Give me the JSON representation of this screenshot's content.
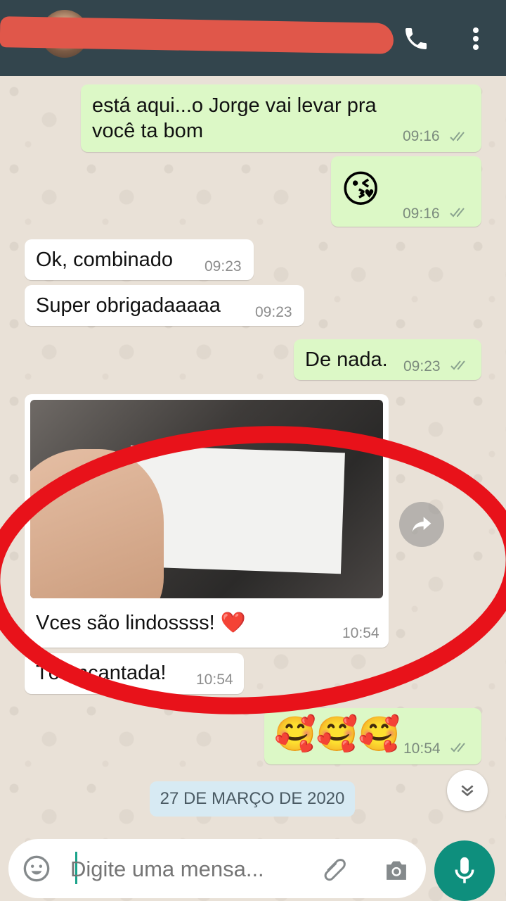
{
  "header": {
    "contact_name": "",
    "call_icon": "phone-icon",
    "menu_icon": "more-vert-icon"
  },
  "messages": [
    {
      "side": "out",
      "text_line1": "está aqui...o Jorge vai levar pra",
      "text_line2": "você ta bom",
      "time": "09:16"
    },
    {
      "side": "out",
      "emoji": "😘",
      "time": "09:16"
    },
    {
      "side": "in",
      "text": "Ok, combinado",
      "time": "09:23"
    },
    {
      "side": "in",
      "text": "Super obrigadaaaaa",
      "time": "09:23"
    },
    {
      "side": "out",
      "text": "De nada.",
      "time": "09:23"
    },
    {
      "side": "in",
      "caption": "Vces são lindossss! ❤️",
      "time": "10:54"
    },
    {
      "side": "in",
      "text": "Tô encantada!",
      "time": "10:54"
    },
    {
      "side": "out",
      "emoji": "🥰🥰🥰",
      "time": "10:54"
    }
  ],
  "date_chip": "27 DE MARÇO DE 2020",
  "composer": {
    "placeholder": "Digite uma mensa...",
    "emoji_icon": "emoji-icon",
    "attach_icon": "paperclip-icon",
    "camera_icon": "camera-icon",
    "mic_icon": "mic-icon"
  },
  "colors": {
    "header": "#33454d",
    "outgoing": "#dcf8c6",
    "incoming": "#ffffff",
    "accent": "#0e8f7d",
    "annotation": "#e8121a"
  }
}
